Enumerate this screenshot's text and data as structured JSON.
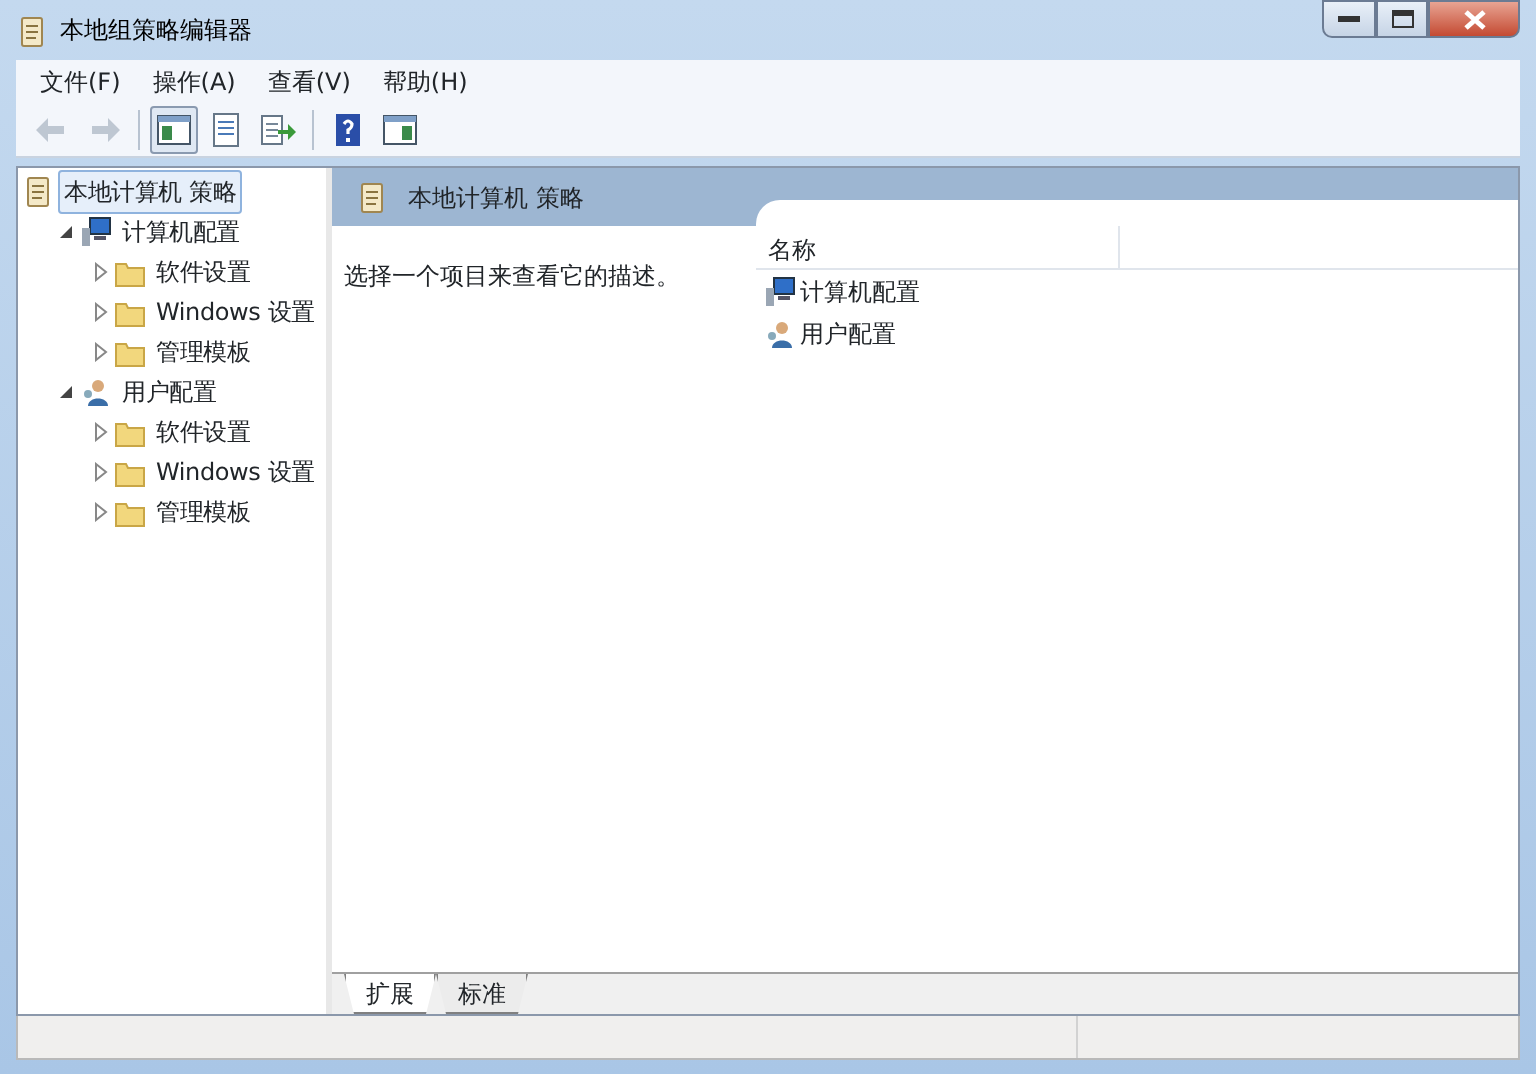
{
  "window": {
    "title": "本地组策略编辑器"
  },
  "menu": [
    "文件(F)",
    "操作(A)",
    "查看(V)",
    "帮助(H)"
  ],
  "toolbar": [
    {
      "kind": "back",
      "disabled": true,
      "pressed": false
    },
    {
      "kind": "forward",
      "disabled": true,
      "pressed": false
    },
    {
      "kind": "tree-pane",
      "disabled": false,
      "pressed": true
    },
    {
      "kind": "properties",
      "disabled": false,
      "pressed": false
    },
    {
      "kind": "export",
      "disabled": false,
      "pressed": false
    },
    {
      "kind": "help",
      "disabled": false,
      "pressed": false
    },
    {
      "kind": "action-pane",
      "disabled": false,
      "pressed": false
    }
  ],
  "tree": [
    {
      "label": "本地计算机 策略",
      "kind": "policy",
      "selected": true,
      "children": [
        {
          "label": "计算机配置",
          "kind": "computer",
          "selected": false,
          "expanded": true,
          "children": [
            {
              "label": "软件设置",
              "kind": "folder",
              "selected": false,
              "expanded": false
            },
            {
              "label": "Windows 设置",
              "kind": "folder",
              "selected": false,
              "expanded": false
            },
            {
              "label": "管理模板",
              "kind": "folder",
              "selected": false,
              "expanded": false
            }
          ]
        },
        {
          "label": "用户配置",
          "kind": "user",
          "selected": false,
          "expanded": true,
          "children": [
            {
              "label": "软件设置",
              "kind": "folder",
              "selected": false,
              "expanded": false
            },
            {
              "label": "Windows 设置",
              "kind": "folder",
              "selected": false,
              "expanded": false
            },
            {
              "label": "管理模板",
              "kind": "folder",
              "selected": false,
              "expanded": false
            }
          ]
        }
      ]
    }
  ],
  "details": {
    "title": "本地计算机 策略",
    "description": "选择一个项目来查看它的描述。",
    "columns": [
      "名称"
    ],
    "rows": [
      {
        "label": "计算机配置",
        "kind": "computer"
      },
      {
        "label": "用户配置",
        "kind": "user"
      }
    ]
  },
  "tabs": [
    {
      "label": "扩展",
      "selected": true
    },
    {
      "label": "标准",
      "selected": false
    }
  ]
}
